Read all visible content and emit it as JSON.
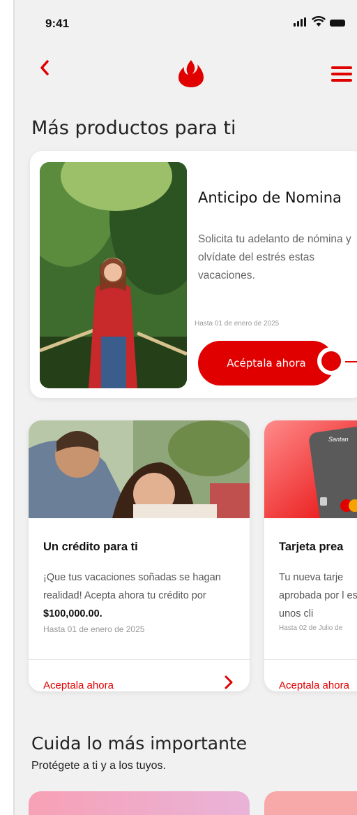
{
  "status_bar": {
    "time": "9:41"
  },
  "nav": {
    "back_icon": "chevron-left-icon",
    "logo_icon": "santander-flame-icon",
    "menu_icon": "hamburger-icon"
  },
  "section1": {
    "title": "Más productos para ti"
  },
  "featured": {
    "title": "Anticipo de Nomina",
    "description": "Solicita tu adelanto de nómina y olvídate del estrés estas vacaciones.",
    "date": "Hasta 01 de enero de 2025",
    "button": "Acéptala ahora"
  },
  "cards": [
    {
      "title": "Un crédito para ti",
      "description_text": "¡Que tus vacaciones soñadas se hagan realidad! Acepta ahora tu crédito por ",
      "description_amount": "$100,000.00.",
      "date": "Hasta 01 de enero de 2025",
      "link": "Aceptala ahora"
    },
    {
      "title": "Tarjeta prea",
      "description_text": "Tu nueva tarje aprobada por l está a unos cli",
      "image_text": "Santan",
      "date": "Hasta 02 de Julio de",
      "link": "Aceptala ahora"
    }
  ],
  "section2": {
    "title": "Cuida lo más importante",
    "subtitle": "Protégete a ti y a los tuyos."
  },
  "colors": {
    "brand_red": "#e00000",
    "background": "#f1f1f1"
  }
}
